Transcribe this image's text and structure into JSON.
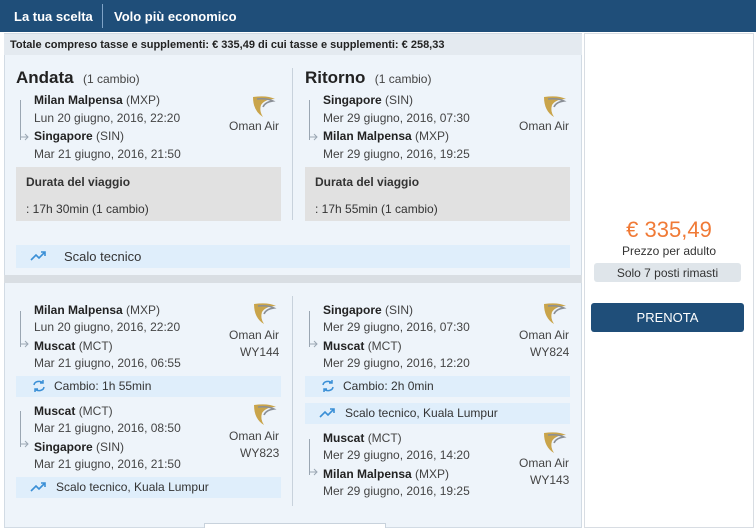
{
  "header": {
    "tab_choice": "La tua scelta",
    "tab_cheapest": "Volo più economico"
  },
  "total_label": "Totale compreso tasse e supplementi: € 335,49 di cui tasse e supplementi: € 258,33",
  "summary": {
    "outbound": {
      "title": "Andata",
      "stops": "(1 cambio)",
      "from_city": "Milan Malpensa",
      "from_code": "(MXP)",
      "depart": "Lun 20 giugno, 2016, 22:20",
      "to_city": "Singapore",
      "to_code": "(SIN)",
      "arrive": "Mar 21 giugno, 2016, 21:50",
      "airline": "Oman Air",
      "duration_label": "Durata del viaggio",
      "duration_value": ":  17h 30min (1 cambio)"
    },
    "return": {
      "title": "Ritorno",
      "stops": "(1 cambio)",
      "from_city": "Singapore",
      "from_code": "(SIN)",
      "depart": "Mer 29 giugno, 2016, 07:30",
      "to_city": "Milan Malpensa",
      "to_code": "(MXP)",
      "arrive": "Mer 29 giugno, 2016, 19:25",
      "airline": "Oman Air",
      "duration_label": "Durata del viaggio",
      "duration_value": ":  17h 55min (1 cambio)"
    },
    "tech_stop": "Scalo tecnico"
  },
  "details": {
    "outbound": {
      "seg1": {
        "from_city": "Milan Malpensa",
        "from_code": "(MXP)",
        "depart": "Lun 20 giugno, 2016, 22:20",
        "to_city": "Muscat",
        "to_code": "(MCT)",
        "arrive": "Mar 21 giugno, 2016, 06:55",
        "airline": "Oman Air",
        "flight": "WY144"
      },
      "change": "Cambio: 1h 55min",
      "seg2": {
        "from_city": "Muscat",
        "from_code": "(MCT)",
        "depart": "Mar 21 giugno, 2016, 08:50",
        "to_city": "Singapore",
        "to_code": "(SIN)",
        "arrive": "Mar 21 giugno, 2016, 21:50",
        "airline": "Oman Air",
        "flight": "WY823"
      },
      "tech_stop": "Scalo tecnico, Kuala Lumpur"
    },
    "return": {
      "seg1": {
        "from_city": "Singapore",
        "from_code": "(SIN)",
        "depart": "Mer 29 giugno, 2016, 07:30",
        "to_city": "Muscat",
        "to_code": "(MCT)",
        "arrive": "Mer 29 giugno, 2016, 12:20",
        "airline": "Oman Air",
        "flight": "WY824"
      },
      "change": "Cambio: 2h 0min",
      "tech_stop": "Scalo tecnico, Kuala Lumpur",
      "seg2": {
        "from_city": "Muscat",
        "from_code": "(MCT)",
        "depart": "Mer 29 giugno, 2016, 14:20",
        "to_city": "Milan Malpensa",
        "to_code": "(MXP)",
        "arrive": "Mer 29 giugno, 2016, 19:25",
        "airline": "Oman Air",
        "flight": "WY143"
      }
    }
  },
  "pricing": {
    "price": "€ 335,49",
    "per_adult": "Prezzo per adulto",
    "seats": "Solo 7 posti rimasti",
    "book": "PRENOTA"
  },
  "colors": {
    "header": "#1f4e79",
    "price": "#f07a36",
    "info": "#dfeefb",
    "icon": "#3a8fd6"
  }
}
